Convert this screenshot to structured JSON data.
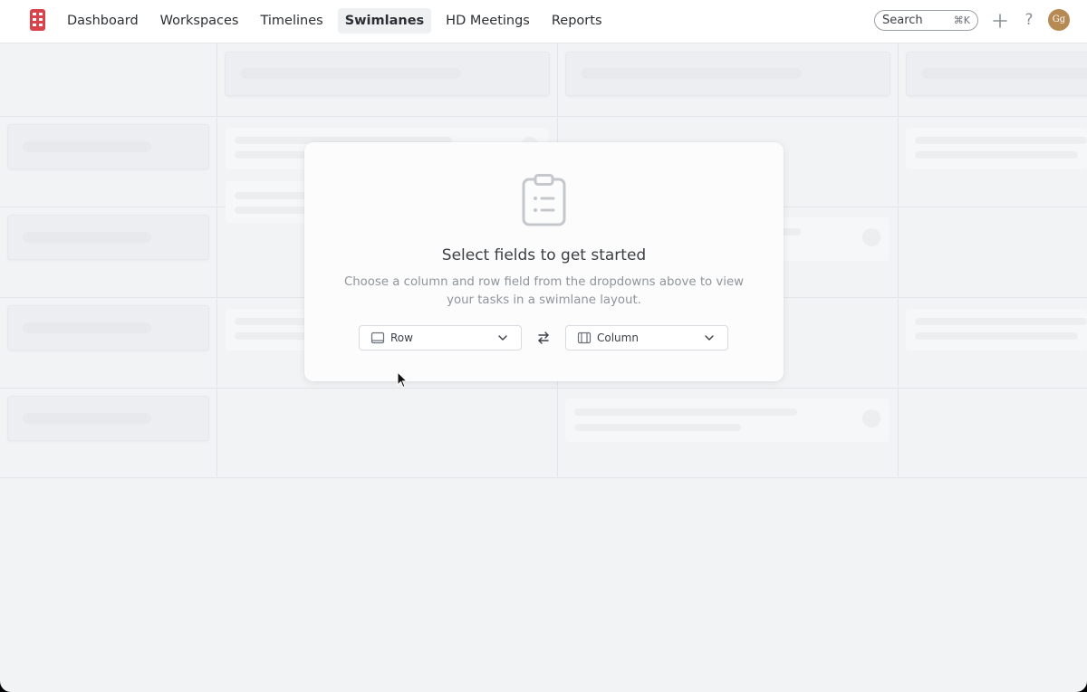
{
  "nav": {
    "items": [
      {
        "label": "Dashboard",
        "active": false
      },
      {
        "label": "Workspaces",
        "active": false
      },
      {
        "label": "Timelines",
        "active": false
      },
      {
        "label": "Swimlanes",
        "active": true
      },
      {
        "label": "HD Meetings",
        "active": false
      },
      {
        "label": "Reports",
        "active": false
      }
    ],
    "search_label": "Search",
    "search_shortcut": "⌘K",
    "avatar_initials": "Gg"
  },
  "modal": {
    "title": "Select fields to get started",
    "description": "Choose a column and row field from the dropdowns above to view your tasks in a swimlane layout.",
    "row_select": {
      "selected": "Row"
    },
    "column_select": {
      "selected": "Column"
    }
  },
  "colors": {
    "brand_red": "#d9434a",
    "avatar_bg": "#b68a52"
  },
  "icons": [
    "app-logo-icon",
    "plus-icon",
    "help-icon",
    "clipboard-list-icon",
    "row-layout-icon",
    "column-layout-icon",
    "chevron-down-icon",
    "swap-arrows-icon",
    "mouse-pointer-icon"
  ]
}
